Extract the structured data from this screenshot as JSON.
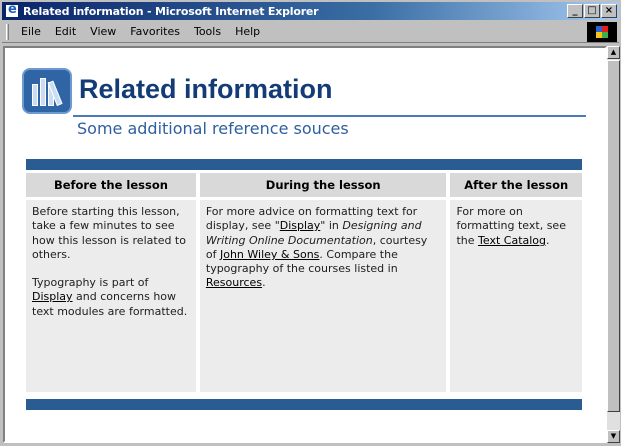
{
  "window": {
    "title": "Related information - Microsoft Internet Explorer",
    "buttons": [
      "_",
      "□",
      "×"
    ]
  },
  "menu": [
    {
      "label": "Eile"
    },
    {
      "label": "Edit"
    },
    {
      "label": "View"
    },
    {
      "label": "Favorites"
    },
    {
      "label": "Tools"
    },
    {
      "label": "Help"
    }
  ],
  "page": {
    "title": "Related information",
    "subtitle": "Some additional reference souces",
    "icon": "books-icon"
  },
  "table": {
    "headers": [
      "Before the lesson",
      "During the lesson",
      "After the lesson"
    ],
    "before": {
      "p1": "Before starting this lesson, take a few minutes to see how this lesson is related to others.",
      "p2_pre": "Typography is part of ",
      "p2_link": "Display",
      "p2_post": " and concerns how text modules are formatted."
    },
    "during": {
      "t1": "For more advice on formatting text for display, see \"",
      "link1": "Display",
      "t2": "\" in ",
      "em1": "Designing and Writing Online Documentation",
      "t3": ", courtesy of ",
      "link2": "John Wiley & Sons",
      "t4": ". Compare the typography of the courses listed in ",
      "link3": "Resources",
      "t5": "."
    },
    "after": {
      "t1": "For more on formatting text, see the ",
      "link1": "Text Catalog",
      "t2": "."
    }
  },
  "colors": {
    "band": "#2a5c94",
    "title": "#123b78",
    "header_bg": "#d9d9d9",
    "cell_bg": "#ececec"
  }
}
